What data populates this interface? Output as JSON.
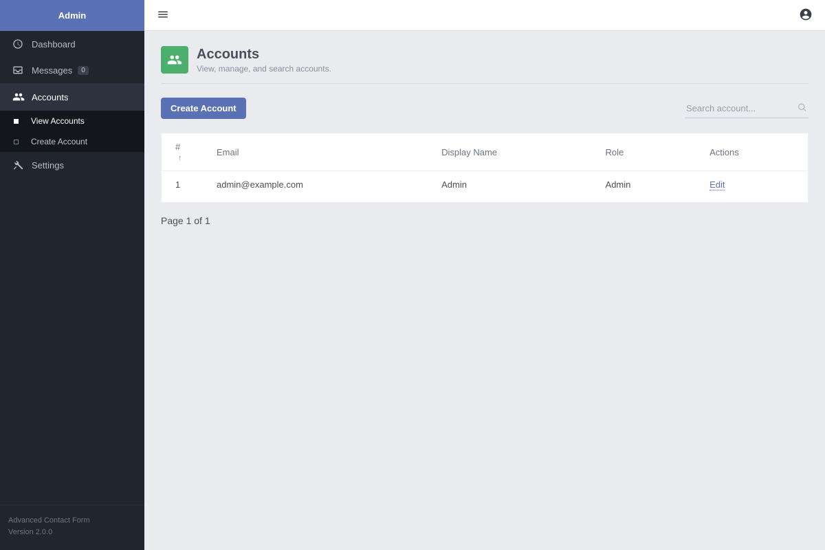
{
  "brand": "Admin",
  "sidebar": {
    "items": [
      {
        "key": "dashboard",
        "label": "Dashboard"
      },
      {
        "key": "messages",
        "label": "Messages",
        "badge": "0"
      },
      {
        "key": "accounts",
        "label": "Accounts"
      },
      {
        "key": "settings",
        "label": "Settings"
      }
    ],
    "accounts_sub": [
      {
        "key": "view",
        "label": "View Accounts"
      },
      {
        "key": "create",
        "label": "Create Account"
      }
    ]
  },
  "footer": {
    "line1": "Advanced Contact Form",
    "line2": "Version 2.0.0"
  },
  "page": {
    "title": "Accounts",
    "subtitle": "View, manage, and search accounts."
  },
  "actions": {
    "create_account": "Create Account"
  },
  "search": {
    "placeholder": "Search account..."
  },
  "table": {
    "columns": {
      "num": "#",
      "email": "Email",
      "display_name": "Display Name",
      "role": "Role",
      "actions": "Actions"
    },
    "rows": [
      {
        "num": "1",
        "email": "admin@example.com",
        "display_name": "Admin",
        "role": "Admin",
        "action_label": "Edit"
      }
    ]
  },
  "pagination": "Page 1 of 1"
}
